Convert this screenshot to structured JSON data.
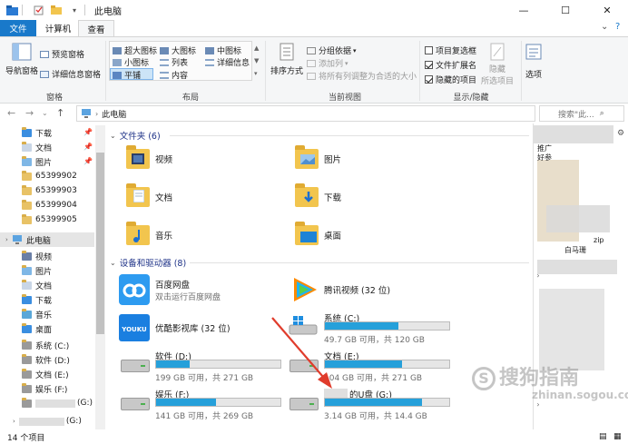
{
  "window": {
    "title": "此电脑",
    "minimize": "—",
    "maximize": "☐",
    "close": "✕"
  },
  "tabs": {
    "file": "文件",
    "computer": "计算机",
    "view": "查看",
    "collapse": "⌄",
    "help": "?"
  },
  "ribbon": {
    "pane_group": {
      "nav_pane": "导航窗格",
      "preview_pane": "预览窗格",
      "details_pane": "详细信息窗格",
      "label": "窗格"
    },
    "layout_group": {
      "extra_large": "超大图标",
      "large": "大图标",
      "medium": "中图标",
      "small": "小图标",
      "list": "列表",
      "details": "详细信息",
      "tiles": "平铺",
      "content": "内容",
      "label": "布局"
    },
    "current_view_group": {
      "sort": "排序方式",
      "group_by": "分组依据",
      "add_column": "添加列",
      "fit_columns": "将所有列调整为合适的大小",
      "label": "当前视图"
    },
    "show_hide_group": {
      "item_checkbox": "项目复选框",
      "file_ext": "文件扩展名",
      "hidden_items": "隐藏的项目",
      "hide_selected_1": "隐藏",
      "hide_selected_2": "所选项目",
      "label": "显示/隐藏",
      "item_checkbox_checked": false,
      "file_ext_checked": true,
      "hidden_items_checked": true
    },
    "options": "选项"
  },
  "address": {
    "path": "此电脑",
    "search_placeholder": "搜索\"此..."
  },
  "sidebar": {
    "items": [
      {
        "label": "下载",
        "pinned": true
      },
      {
        "label": "文档",
        "pinned": true
      },
      {
        "label": "图片",
        "pinned": true
      },
      {
        "label": "65399902",
        "pinned": false
      },
      {
        "label": "65399903",
        "pinned": false
      },
      {
        "label": "65399904",
        "pinned": false
      },
      {
        "label": "65399905",
        "pinned": false
      }
    ],
    "this_pc": "此电脑",
    "pc_children": [
      "视频",
      "图片",
      "文档",
      "下载",
      "音乐",
      "桌面"
    ],
    "drives": [
      "系统 (C:)",
      "软件 (D:)",
      "文档 (E:)",
      "娱乐 (F:)",
      "(G:)",
      "(G:)"
    ]
  },
  "folders_section": {
    "title": "文件夹 (6)",
    "items": [
      "视频",
      "图片",
      "文档",
      "下载",
      "音乐",
      "桌面"
    ]
  },
  "devices_section": {
    "title": "设备和驱动器 (8)",
    "apps": [
      {
        "name": "百度网盘",
        "sub": "双击运行百度网盘"
      },
      {
        "name": "腾讯视频 (32 位)",
        "sub": ""
      },
      {
        "name": "优酷影视库 (32 位)",
        "sub": ""
      }
    ],
    "drives": [
      {
        "name": "系统 (C:)",
        "free": "49.7 GB 可用，共 120 GB",
        "used_fraction": 0.59
      },
      {
        "name": "软件 (D:)",
        "free": "199 GB 可用，共 271 GB",
        "used_fraction": 0.27
      },
      {
        "name": "文档 (E:)",
        "free": "104 GB 可用，共 271 GB",
        "used_fraction": 0.62
      },
      {
        "name": "娱乐 (F:)",
        "free": "141 GB 可用，共 269 GB",
        "used_fraction": 0.48
      },
      {
        "name": "的U盘 (G:)",
        "free": "3.14 GB 可用，共 14.4 GB",
        "used_fraction": 0.78
      }
    ]
  },
  "status": {
    "count": "14 个项目"
  },
  "preview": {
    "items": [
      "推广",
      "好参",
      "zip",
      "白马珊"
    ]
  },
  "watermark": {
    "text": "搜狗指南",
    "url": "zhinan.sogou.com"
  },
  "colors": {
    "accent": "#1979ca",
    "drive_bar": "#26a0da",
    "section_title": "#1e3287",
    "arrow": "#e03c2c"
  }
}
